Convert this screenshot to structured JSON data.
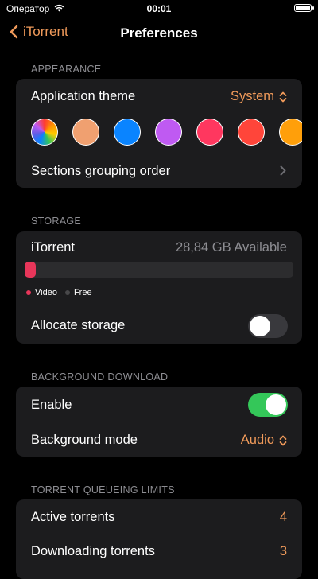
{
  "status_bar": {
    "carrier": "Оператор",
    "time": "00:01"
  },
  "nav": {
    "back_label": "iTorrent",
    "title": "Preferences"
  },
  "appearance": {
    "header": "APPEARANCE",
    "theme_label": "Application theme",
    "theme_value": "System",
    "swatches": [
      "rainbow",
      "#f0a070",
      "#0a84ff",
      "#bf5af2",
      "#ff375f",
      "#ff453a",
      "#ff9f0a"
    ],
    "grouping_label": "Sections grouping order"
  },
  "storage": {
    "header": "STORAGE",
    "app_name": "iTorrent",
    "available": "28,84 GB Available",
    "used_fraction": 0.04,
    "legend": [
      {
        "label": "Video",
        "color": "#e8365a"
      },
      {
        "label": "Free",
        "color": "#48484a"
      }
    ],
    "allocate_label": "Allocate storage",
    "allocate_on": false
  },
  "background_download": {
    "header": "BACKGROUND DOWNLOAD",
    "enable_label": "Enable",
    "enable_on": true,
    "mode_label": "Background mode",
    "mode_value": "Audio"
  },
  "queueing": {
    "header": "TORRENT QUEUEING LIMITS",
    "active_label": "Active torrents",
    "active_value": "4",
    "downloading_label": "Downloading torrents",
    "downloading_value": "3"
  },
  "colors": {
    "accent": "#f09a5a",
    "background": "#000000",
    "cell": "#1c1c1e",
    "toggle_on": "#34c759"
  }
}
